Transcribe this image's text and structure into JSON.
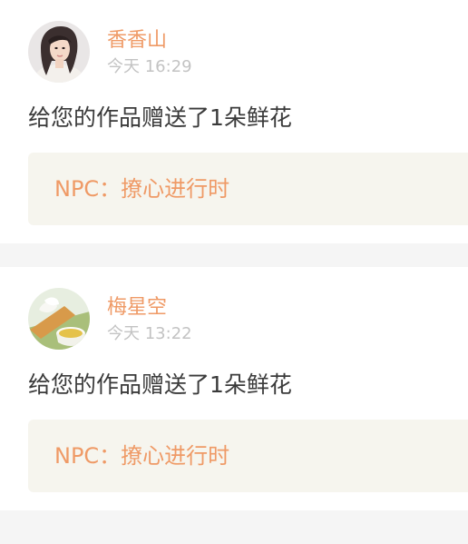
{
  "notifications": [
    {
      "username": "香香山",
      "time": "今天 16:29",
      "message": "给您的作品赠送了1朵鲜花",
      "work_title": "NPC：撩心进行时",
      "avatar_icon": "portrait-avatar"
    },
    {
      "username": "梅星空",
      "time": "今天 13:22",
      "message": "给您的作品赠送了1朵鲜花",
      "work_title": "NPC：撩心进行时",
      "avatar_icon": "tea-cup-avatar"
    }
  ],
  "colors": {
    "accent": "#ef9a66",
    "timestamp": "#c3c3c3",
    "message_text": "#3a3a3a",
    "work_box_bg": "#f6f5ee",
    "page_bg": "#f5f5f5",
    "card_bg": "#ffffff"
  }
}
